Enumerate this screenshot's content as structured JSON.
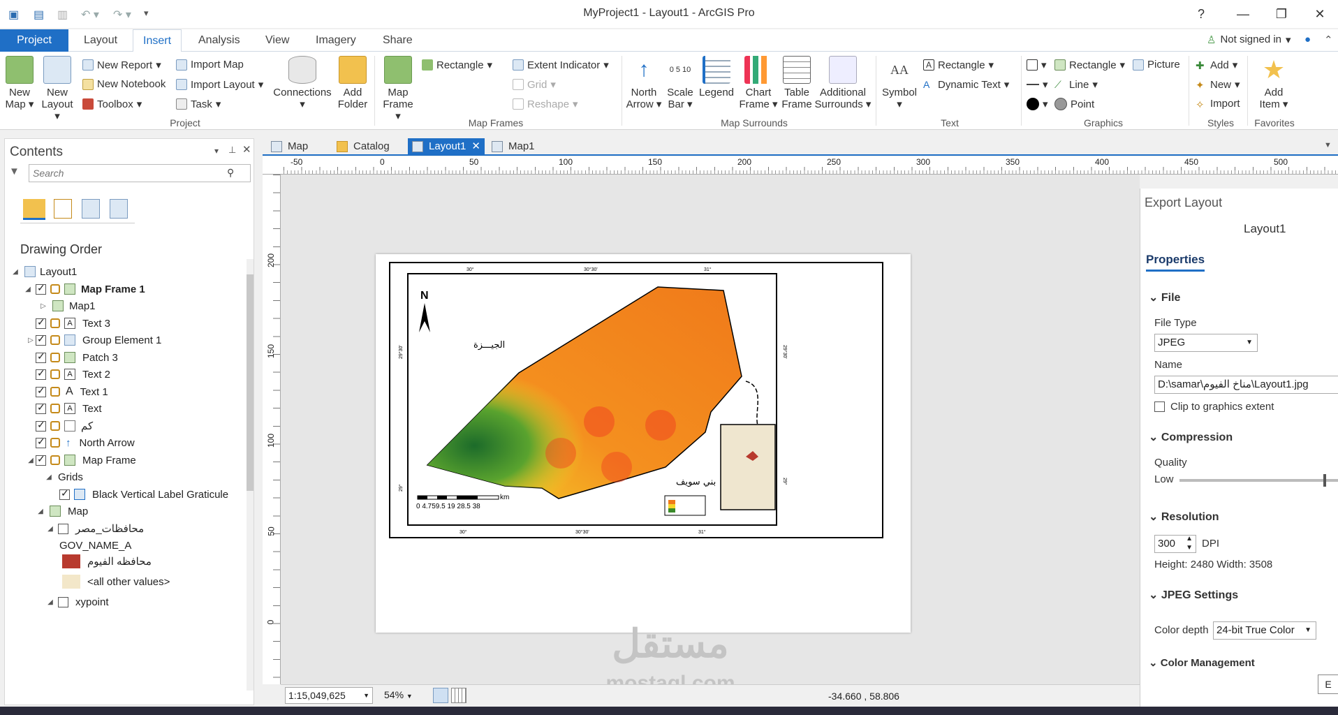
{
  "window": {
    "title": "MyProject1 - Layout1 - ArcGIS Pro",
    "help": "?"
  },
  "ribbon_tabs": [
    "Project",
    "Layout",
    "Insert",
    "Analysis",
    "View",
    "Imagery",
    "Share"
  ],
  "signin": "Not signed in",
  "ribbon": {
    "project": {
      "new_map": "New Map",
      "new_layout": "New Layout",
      "new_report": "New Report",
      "new_notebook": "New Notebook",
      "toolbox": "Toolbox",
      "import_map": "Import Map",
      "import_layout": "Import Layout",
      "task": "Task",
      "connections": "Connections",
      "add_folder": "Add Folder",
      "group": "Project"
    },
    "map_frames": {
      "map_frame": "Map Frame",
      "rectangle": "Rectangle",
      "extent_indicator": "Extent Indicator",
      "grid": "Grid",
      "reshape": "Reshape",
      "group": "Map Frames"
    },
    "surrounds": {
      "north_arrow": "North Arrow",
      "scale_bar": "Scale Bar",
      "legend": "Legend",
      "chart_frame": "Chart Frame",
      "table_frame": "Table Frame",
      "additional": "Additional Surrounds",
      "group": "Map Surrounds",
      "scale_label": "0 5 10"
    },
    "text": {
      "symbol": "Symbol",
      "rectangle": "Rectangle",
      "dynamic_text": "Dynamic Text",
      "group": "Text"
    },
    "graphics": {
      "rectangle": "Rectangle",
      "picture": "Picture",
      "line": "Line",
      "point": "Point",
      "group": "Graphics"
    },
    "styles": {
      "add": "Add",
      "new": "New",
      "import": "Import",
      "group": "Styles"
    },
    "favorites": {
      "add_item": "Add Item",
      "group": "Favorites"
    }
  },
  "contents": {
    "title": "Contents",
    "search_placeholder": "Search",
    "section": "Drawing Order",
    "items": [
      {
        "label": "Layout1",
        "level": 0
      },
      {
        "label": "Map Frame 1",
        "level": 1
      },
      {
        "label": "Map1",
        "level": 2
      },
      {
        "label": "Text 3",
        "level": 1
      },
      {
        "label": "Group Element 1",
        "level": 1
      },
      {
        "label": "Patch 3",
        "level": 1
      },
      {
        "label": "Text 2",
        "level": 1
      },
      {
        "label": "Text 1",
        "level": 1
      },
      {
        "label": "Text",
        "level": 1
      },
      {
        "label": "كم",
        "level": 1
      },
      {
        "label": "North Arrow",
        "level": 1
      },
      {
        "label": "Map Frame",
        "level": 1
      },
      {
        "label": "Grids",
        "level": 2
      },
      {
        "label": "Black Vertical Label Graticule",
        "level": 3
      },
      {
        "label": "Map",
        "level": 2
      },
      {
        "label": "محافظات_مصر",
        "level": 3
      },
      {
        "label": "GOV_NAME_A",
        "level": 3
      },
      {
        "label": "محافظه الفيوم",
        "level": 3
      },
      {
        "label": "<all other values>",
        "level": 3
      },
      {
        "label": "xypoint",
        "level": 3
      }
    ]
  },
  "doc_tabs": [
    "Map",
    "Catalog",
    "Layout1",
    "Map1"
  ],
  "ruler_h": [
    "-50",
    "0",
    "50",
    "100",
    "150",
    "200",
    "250",
    "300",
    "350",
    "400",
    "450",
    "500"
  ],
  "ruler_v": [
    "200",
    "150",
    "100",
    "50",
    "0"
  ],
  "map": {
    "top_ticks": [
      "30°",
      "30°30'",
      "31°"
    ],
    "bottom_ticks": [
      "30°",
      "30°30'",
      "31°"
    ],
    "left_ticks": [
      "29°30'",
      "29°"
    ],
    "right_ticks": [
      "29°30'",
      "29°"
    ],
    "north": "N",
    "label_giza": "الجيـــزة",
    "label_benisuef": "بني سويف",
    "scale": "0 4.759.5    19    28.5    38",
    "km": "km"
  },
  "export": {
    "title": "Export Layout",
    "subtitle": "Layout1",
    "tab": "Properties",
    "file_section": "File",
    "file_type_label": "File Type",
    "file_type": "JPEG",
    "name_label": "Name",
    "name_value": "D:\\samar\\مناخ الفيوم\\Layout1.jpg",
    "clip_label": "Clip to graphics extent",
    "compression_section": "Compression",
    "quality_label": "Quality",
    "quality_low": "Low",
    "quality_level": 0.92,
    "resolution_section": "Resolution",
    "dpi_value": "300",
    "dpi_label": "DPI",
    "size_text": "Height: 2480 Width: 3508",
    "jpeg_section": "JPEG Settings",
    "color_depth_label": "Color depth",
    "color_depth": "24-bit True Color",
    "color_mgmt_section": "Color Management",
    "cut_button": "E"
  },
  "status": {
    "scale": "1:15,049,625",
    "zoom": "54%",
    "coords": "-34.660 , 58.806"
  },
  "watermark": {
    "arabic": "مستقل",
    "latin": "mostaql.com"
  },
  "colors": {
    "accent": "#1f6fc6"
  }
}
